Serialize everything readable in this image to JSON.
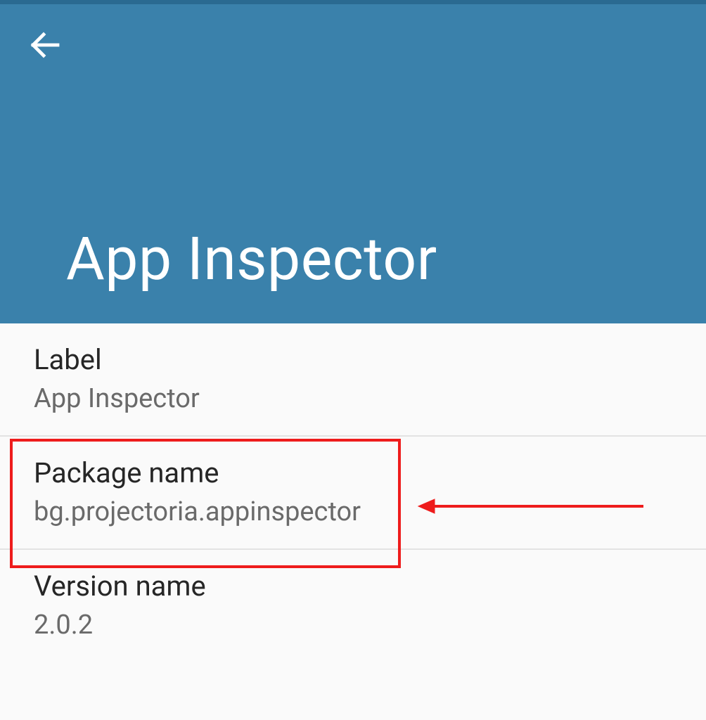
{
  "header": {
    "title": "App Inspector"
  },
  "rows": [
    {
      "label": "Label",
      "value": "App Inspector"
    },
    {
      "label": "Package name",
      "value": "bg.projectoria.appinspector"
    },
    {
      "label": "Version name",
      "value": "2.0.2"
    }
  ],
  "annotation": {
    "highlight_row_index": 1
  }
}
